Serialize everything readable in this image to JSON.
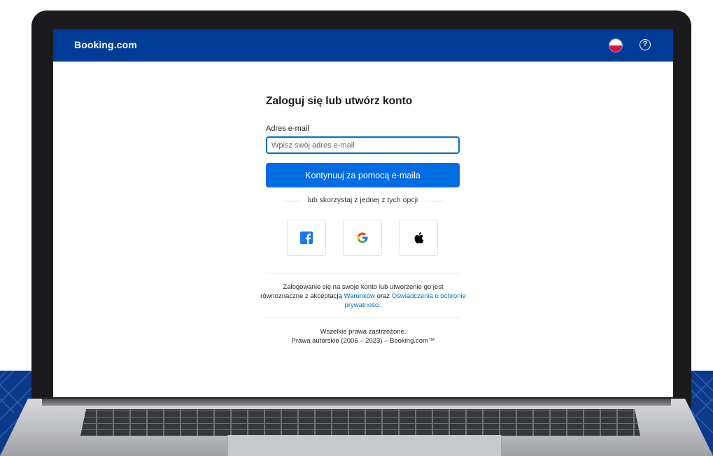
{
  "header": {
    "brand": "Booking.com",
    "brand_color": "#003b95"
  },
  "form": {
    "title": "Zaloguj się lub utwórz konto",
    "email_label": "Adres e-mail",
    "email_placeholder": "Wpisz swój adres e-mail",
    "email_value": "",
    "continue_label": "Kontynuuj za pomocą e-maila",
    "continue_color": "#006ce4",
    "divider_text": "lub skorzystaj z jednej z tych opcji"
  },
  "social": [
    {
      "name": "facebook",
      "icon": "facebook-icon"
    },
    {
      "name": "google",
      "icon": "google-icon"
    },
    {
      "name": "apple",
      "icon": "apple-icon"
    }
  ],
  "terms": {
    "line1": "Zalogowanie się na swoje konto lub utworzenie go jest",
    "line2_prefix": "równoznaczne z akceptacją ",
    "terms_link": "Warunków",
    "conjunction": " oraz ",
    "privacy_link": "Oświadczenia o ochronie prywatności",
    "suffix": "."
  },
  "footer": {
    "rights": "Wszelkie prawa zastrzeżone.",
    "copyright": "Prawa autorskie (2006 – 2023) – Booking.com™"
  }
}
